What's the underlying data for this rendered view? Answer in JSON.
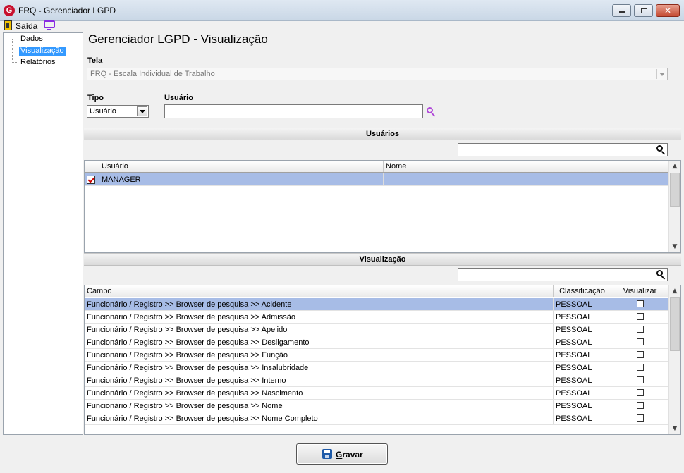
{
  "window": {
    "title": "FRQ - Gerenciador LGPD",
    "app_icon_letter": "G",
    "minimize_glyph": "",
    "maximize_glyph": "",
    "close_glyph": "✕"
  },
  "menu": {
    "exit_label": "Saída"
  },
  "tree": {
    "items": [
      {
        "label": "Dados",
        "selected": false
      },
      {
        "label": "Visualização",
        "selected": true
      },
      {
        "label": "Relatórios",
        "selected": false
      }
    ]
  },
  "page": {
    "title": "Gerenciador LGPD - Visualização"
  },
  "form": {
    "tela_label": "Tela",
    "tela_value": "FRQ - Escala Individual de Trabalho",
    "tipo_label": "Tipo",
    "tipo_value": "Usuário",
    "usuario_label": "Usuário",
    "usuario_value": ""
  },
  "usuarios_section": {
    "title": "Usuários",
    "search_value": "",
    "columns": [
      "Usuário",
      "Nome"
    ],
    "rows": [
      {
        "checked": true,
        "usuario": "MANAGER",
        "nome": ""
      }
    ]
  },
  "visualizacao_section": {
    "title": "Visualização",
    "search_value": "",
    "columns": [
      "Campo",
      "Classificação",
      "Visualizar"
    ],
    "rows": [
      {
        "campo": "Funcionário / Registro >> Browser de pesquisa >> Acidente",
        "classificacao": "PESSOAL",
        "visualizar": false
      },
      {
        "campo": "Funcionário / Registro >> Browser de pesquisa >> Admissão",
        "classificacao": "PESSOAL",
        "visualizar": false
      },
      {
        "campo": "Funcionário / Registro >> Browser de pesquisa >> Apelido",
        "classificacao": "PESSOAL",
        "visualizar": false
      },
      {
        "campo": "Funcionário / Registro >> Browser de pesquisa >> Desligamento",
        "classificacao": "PESSOAL",
        "visualizar": false
      },
      {
        "campo": "Funcionário / Registro >> Browser de pesquisa >> Função",
        "classificacao": "PESSOAL",
        "visualizar": false
      },
      {
        "campo": "Funcionário / Registro >> Browser de pesquisa >> Insalubridade",
        "classificacao": "PESSOAL",
        "visualizar": false
      },
      {
        "campo": "Funcionário / Registro >> Browser de pesquisa >> Interno",
        "classificacao": "PESSOAL",
        "visualizar": false
      },
      {
        "campo": "Funcionário / Registro >> Browser de pesquisa >> Nascimento",
        "classificacao": "PESSOAL",
        "visualizar": false
      },
      {
        "campo": "Funcionário / Registro >> Browser de pesquisa >> Nome",
        "classificacao": "PESSOAL",
        "visualizar": false
      },
      {
        "campo": "Funcionário / Registro >> Browser de pesquisa >> Nome Completo",
        "classificacao": "PESSOAL",
        "visualizar": false
      }
    ]
  },
  "footer": {
    "save_label_accel": "G",
    "save_label_rest": "ravar"
  },
  "colors": {
    "selection": "#3399ff",
    "row_selected": "#a7bce6",
    "search_icon_purple": "#b04ad8",
    "check_red": "#d00000"
  },
  "icons": {
    "exit": "exit-door-icon",
    "monitor": "monitor-icon",
    "search": "search-icon",
    "save": "floppy-disk-icon"
  }
}
